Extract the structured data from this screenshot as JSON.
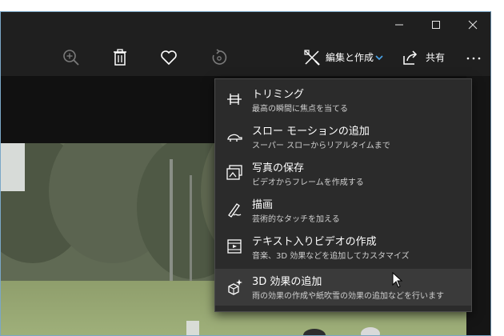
{
  "toolbar": {
    "edit_create_label": "編集と作成",
    "share_label": "共有",
    "icons": [
      "zoom-in-icon",
      "delete-icon",
      "favorite-heart-icon",
      "rotate-icon",
      "edit-create-icon",
      "chevron-down-icon",
      "share-icon",
      "more-icon"
    ]
  },
  "window_controls": [
    "minimize",
    "maximize",
    "close"
  ],
  "menu": {
    "items": [
      {
        "title": "トリミング",
        "subtitle": "最高の瞬間に焦点を当てる",
        "icon": "trim-icon"
      },
      {
        "title": "スロー モーションの追加",
        "subtitle": "スーパー スローからリアルタイムまで",
        "icon": "slow-motion-icon"
      },
      {
        "title": "写真の保存",
        "subtitle": "ビデオからフレームを作成する",
        "icon": "save-photo-icon"
      },
      {
        "title": "描画",
        "subtitle": "芸術的なタッチを加える",
        "icon": "draw-icon"
      },
      {
        "title": "テキスト入りビデオの作成",
        "subtitle": "音楽、3D 効果などを追加してカスタマイズ",
        "icon": "text-video-icon"
      },
      {
        "title": "3D 効果の追加",
        "subtitle": "雨の効果の作成や紙吹雪の効果の追加などを行います",
        "icon": "3d-effects-icon"
      }
    ],
    "hovered_index": 5
  },
  "colors": {
    "accent": "#4aa3e8",
    "menu_bg": "#2b2b2b",
    "hover_bg": "#3a3a3a"
  }
}
